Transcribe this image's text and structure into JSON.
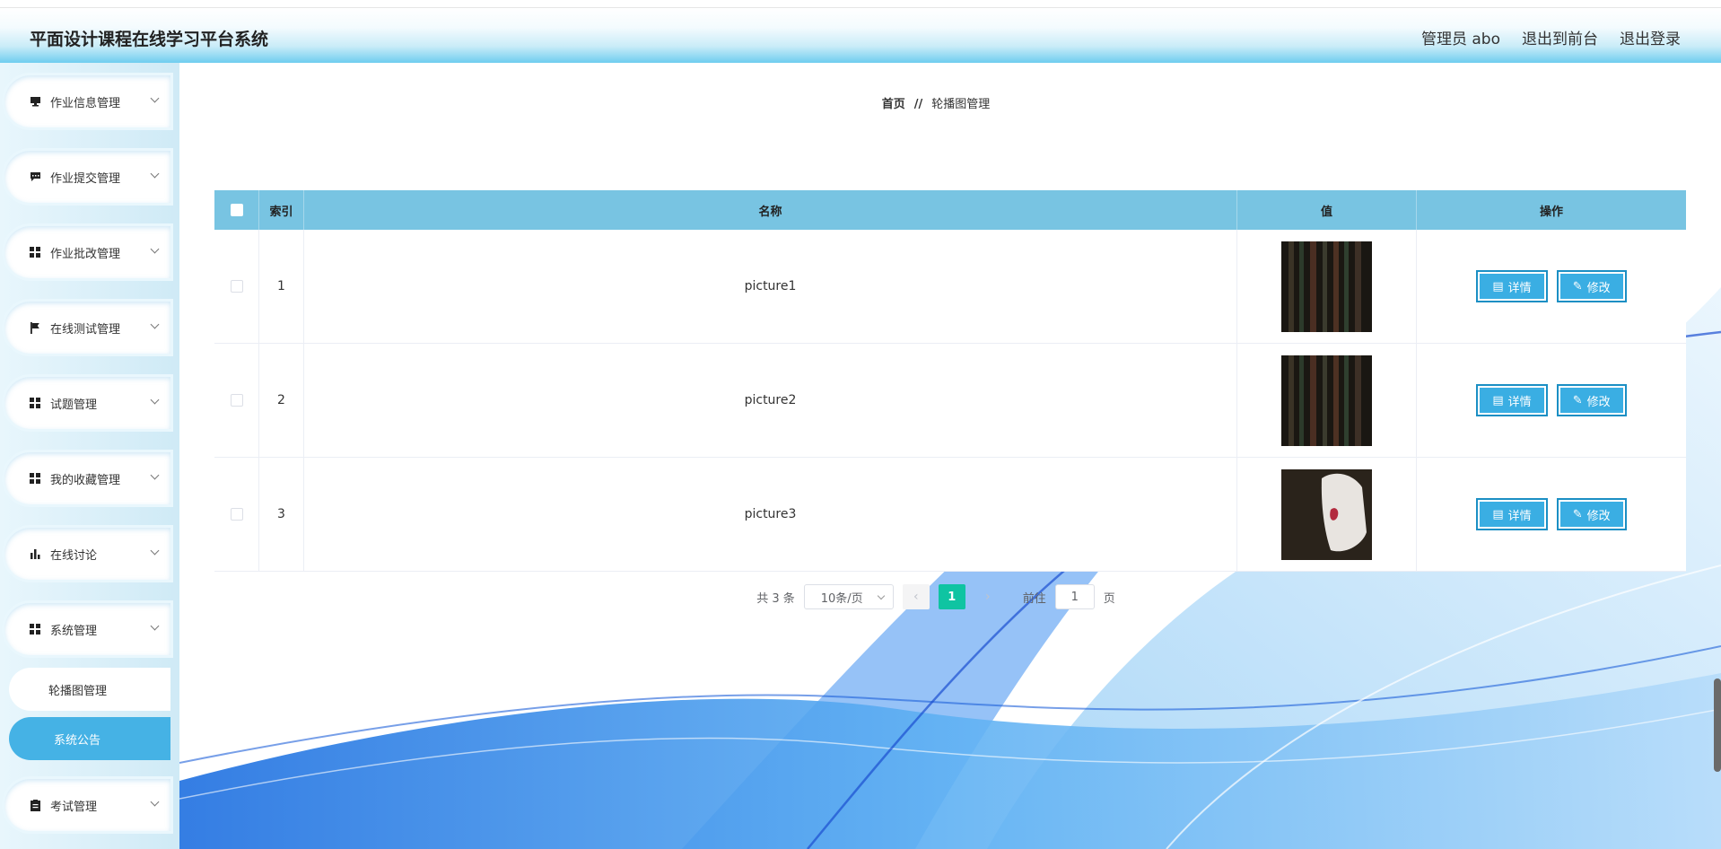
{
  "app": {
    "title": "平面设计课程在线学习平台系统",
    "user_label": "管理员 abo",
    "front_label": "退出到前台",
    "logout_label": "退出登录"
  },
  "sidebar": {
    "items": [
      {
        "label": "作业信息管理",
        "icon": "monitor-icon"
      },
      {
        "label": "作业提交管理",
        "icon": "chat-icon"
      },
      {
        "label": "作业批改管理",
        "icon": "grid-icon"
      },
      {
        "label": "在线测试管理",
        "icon": "flag-icon"
      },
      {
        "label": "试题管理",
        "icon": "grid-icon"
      },
      {
        "label": "我的收藏管理",
        "icon": "grid-icon"
      },
      {
        "label": "在线讨论",
        "icon": "bar-chart-icon"
      },
      {
        "label": "系统管理",
        "icon": "grid-icon"
      },
      {
        "label": "考试管理",
        "icon": "clipboard-icon"
      }
    ],
    "sub_items": [
      {
        "label": "轮播图管理"
      },
      {
        "label": "系统公告"
      }
    ]
  },
  "breadcrumb": {
    "home": "首页",
    "sep": "//",
    "current": "轮播图管理"
  },
  "table": {
    "headers": {
      "index": "索引",
      "name": "名称",
      "value": "值",
      "ops": "操作"
    },
    "rows": [
      {
        "index": "1",
        "name": "picture1",
        "thumb": "dark-stripes"
      },
      {
        "index": "2",
        "name": "picture2",
        "thumb": "dark-stripes"
      },
      {
        "index": "3",
        "name": "picture3",
        "thumb": "white-object"
      }
    ],
    "detail_label": "详情",
    "edit_label": "修改"
  },
  "pager": {
    "total_label": "共 3 条",
    "page_size": "10条/页",
    "current_page": "1",
    "goto_label": "前往",
    "goto_value": "1",
    "page_suffix": "页"
  },
  "colors": {
    "accent": "#45b2e5",
    "header_table": "#78c4e2",
    "page_active": "#0fc4a2",
    "button": "#3aaee3"
  }
}
